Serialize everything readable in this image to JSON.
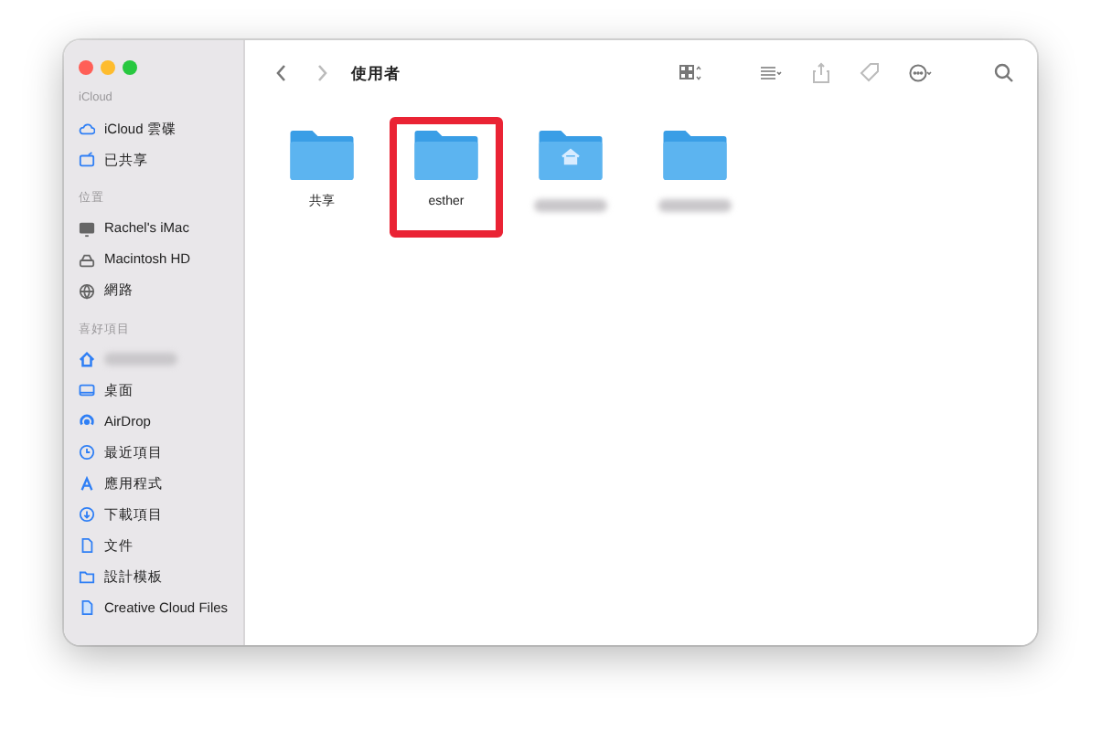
{
  "sidebar": {
    "sections": [
      {
        "header": "iCloud",
        "items": [
          {
            "label": "iCloud 雲碟"
          },
          {
            "label": "已共享"
          }
        ]
      },
      {
        "header": "位置",
        "items": [
          {
            "label": "Rachel's iMac"
          },
          {
            "label": "Macintosh HD"
          },
          {
            "label": "網路"
          }
        ]
      },
      {
        "header": "喜好項目",
        "items": [
          {
            "redacted": true
          },
          {
            "label": "桌面"
          },
          {
            "label": "AirDrop"
          },
          {
            "label": "最近項目"
          },
          {
            "label": "應用程式"
          },
          {
            "label": "下載項目"
          },
          {
            "label": "文件"
          },
          {
            "label": "設計模板"
          },
          {
            "label": "Creative Cloud Files"
          }
        ]
      }
    ]
  },
  "toolbar": {
    "title": "使用者"
  },
  "folders": [
    {
      "label": "共享",
      "kind": "plain",
      "highlighted": false
    },
    {
      "label": "esther",
      "kind": "plain",
      "highlighted": true
    },
    {
      "redacted": true,
      "kind": "home",
      "highlighted": false
    },
    {
      "redacted": true,
      "kind": "plain",
      "highlighted": false
    }
  ]
}
